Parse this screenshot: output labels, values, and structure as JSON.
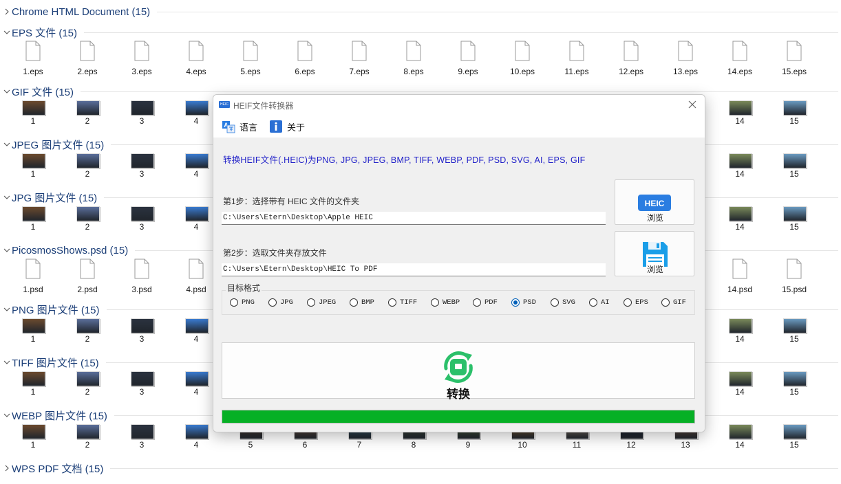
{
  "explorer": {
    "groups": [
      {
        "title": "Chrome HTML Document (15)",
        "kind": "none",
        "labels": []
      },
      {
        "title": "EPS 文件 (15)",
        "kind": "file",
        "labels": [
          "1.eps",
          "2.eps",
          "3.eps",
          "4.eps",
          "5.eps",
          "6.eps",
          "7.eps",
          "8.eps",
          "9.eps",
          "10.eps",
          "11.eps",
          "12.eps",
          "13.eps",
          "14.eps",
          "15.eps"
        ]
      },
      {
        "title": "GIF 文件 (15)",
        "kind": "thumb",
        "labels": [
          "1",
          "2",
          "3",
          "4",
          "",
          "",
          "",
          "",
          "",
          "",
          "",
          "",
          "",
          "14",
          "15"
        ]
      },
      {
        "title": "JPEG 图片文件 (15)",
        "kind": "thumb",
        "labels": [
          "1",
          "2",
          "3",
          "4",
          "",
          "",
          "",
          "",
          "",
          "",
          "",
          "",
          "",
          "14",
          "15"
        ]
      },
      {
        "title": "JPG 图片文件 (15)",
        "kind": "thumb",
        "labels": [
          "1",
          "2",
          "3",
          "4",
          "",
          "",
          "",
          "",
          "",
          "",
          "",
          "",
          "",
          "14",
          "15"
        ]
      },
      {
        "title": "PicosmosShows.psd (15)",
        "kind": "file",
        "labels": [
          "1.psd",
          "2.psd",
          "3.psd",
          "4.psd",
          "",
          "",
          "",
          "",
          "",
          "",
          "",
          "",
          "",
          "14.psd",
          "15.psd"
        ]
      },
      {
        "title": "PNG 图片文件 (15)",
        "kind": "thumb",
        "labels": [
          "1",
          "2",
          "3",
          "4",
          "",
          "",
          "",
          "",
          "",
          "",
          "",
          "",
          "",
          "14",
          "15"
        ]
      },
      {
        "title": "TIFF 图片文件 (15)",
        "kind": "thumb",
        "labels": [
          "1",
          "2",
          "3",
          "4",
          "",
          "",
          "",
          "",
          "",
          "",
          "",
          "",
          "",
          "14",
          "15"
        ]
      },
      {
        "title": "WEBP 图片文件 (15)",
        "kind": "thumb",
        "labels": [
          "1",
          "2",
          "3",
          "4",
          "5",
          "6",
          "7",
          "8",
          "9",
          "10",
          "11",
          "12",
          "13",
          "14",
          "15"
        ]
      },
      {
        "title": "WPS PDF 文档 (15)",
        "kind": "none",
        "labels": []
      }
    ],
    "thumb_colors": [
      "#6b4a2e",
      "#5a6e9a",
      "#2b3340",
      "#3a7bd0",
      "#4a3a30",
      "#6a5040",
      "#3a5a6a",
      "#3e4a3a",
      "#4a5e3a",
      "#7a5a30",
      "#8a7a6a",
      "#1a2030",
      "#6a5040",
      "#7a8a5a",
      "#6a9ac0"
    ]
  },
  "dialog": {
    "title": "HEIF文件转换器",
    "app_icon_text": "HEIC",
    "menu": {
      "language": "语言",
      "about": "关于"
    },
    "description": "转换HEIF文件(.HEIC)为PNG, JPG, JPEG, BMP, TIFF, WEBP, PDF, PSD, SVG, AI, EPS, GIF",
    "step1": {
      "label": "第1步：选择带有 HEIC 文件的文件夹",
      "path": "C:\\Users\\Etern\\Desktop\\Apple HEIC",
      "button": "浏览",
      "badge": "HEIC"
    },
    "step2": {
      "label": "第2步：选取文件夹存放文件",
      "path": "C:\\Users\\Etern\\Desktop\\HEIC To PDF",
      "button": "浏览"
    },
    "format": {
      "title": "目标格式",
      "options": [
        "PNG",
        "JPG",
        "JPEG",
        "BMP",
        "TIFF",
        "WEBP",
        "PDF",
        "PSD",
        "SVG",
        "AI",
        "EPS",
        "GIF"
      ],
      "selected": "PSD"
    },
    "convert_label": "转换",
    "progress": 1.0,
    "colors": {
      "accent_blue": "#1f1fc8",
      "progress_green": "#06b025",
      "convert_green": "#2bc06a",
      "heic_blue": "#2a7de1"
    }
  }
}
